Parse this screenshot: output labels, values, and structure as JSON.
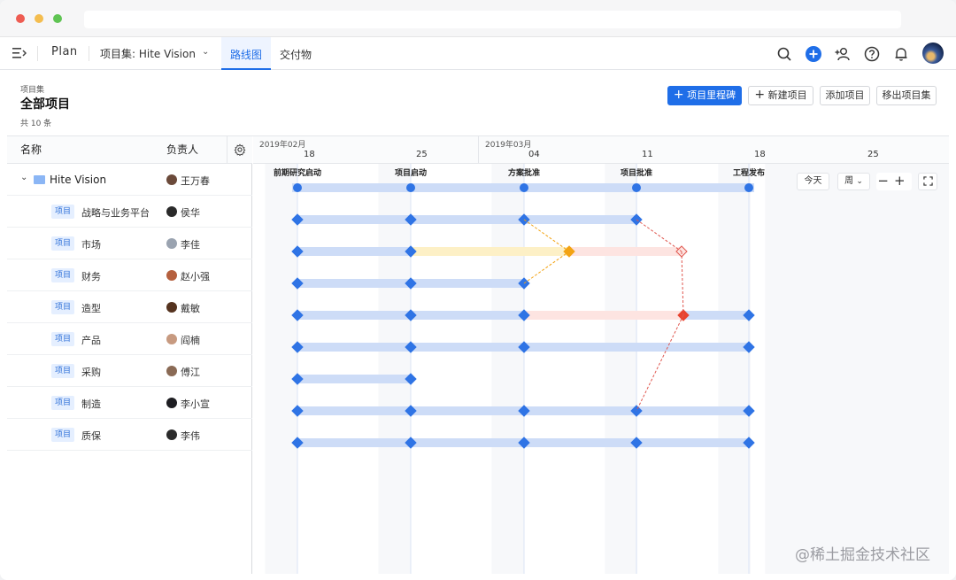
{
  "window": {
    "traffic_colors": [
      "#ee5c52",
      "#f4bd4f",
      "#5fc453"
    ]
  },
  "nav": {
    "app_name": "Plan",
    "project_set": "项目集: Hite Vision",
    "tabs": [
      {
        "label": "路线图",
        "active": true
      },
      {
        "label": "交付物",
        "active": false
      }
    ],
    "accent": "#1f6ee8"
  },
  "header": {
    "breadcrumb": "项目集",
    "title": "全部项目",
    "count": "共 10 条",
    "buttons": {
      "milestone": "项目里程碑",
      "new_project": "新建项目",
      "add_project": "添加项目",
      "remove_set": "移出项目集"
    }
  },
  "table": {
    "col_name": "名称",
    "col_owner": "负责人",
    "group": {
      "name": "Hite Vision",
      "owner": "王万春"
    },
    "tag_label": "项目",
    "rows": [
      {
        "name": "战略与业务平台",
        "owner": "侯华"
      },
      {
        "name": "市场",
        "owner": "李佳"
      },
      {
        "name": "财务",
        "owner": "赵小强"
      },
      {
        "name": "造型",
        "owner": "戴敏"
      },
      {
        "name": "产品",
        "owner": "阎楠"
      },
      {
        "name": "采购",
        "owner": "傅江"
      },
      {
        "name": "制造",
        "owner": "李小宣"
      },
      {
        "name": "质保",
        "owner": "李伟"
      }
    ]
  },
  "timeline": {
    "months": [
      "2019年02月",
      "2019年03月"
    ],
    "days": [
      "18",
      "25",
      "04",
      "11",
      "18",
      "25"
    ],
    "milestones": [
      "前期研究启动",
      "项目启动",
      "方案批准",
      "项目批准",
      "工程发布"
    ],
    "controls": {
      "today": "今天",
      "scale": "周"
    }
  },
  "watermark": "@稀土掘金技术社区"
}
